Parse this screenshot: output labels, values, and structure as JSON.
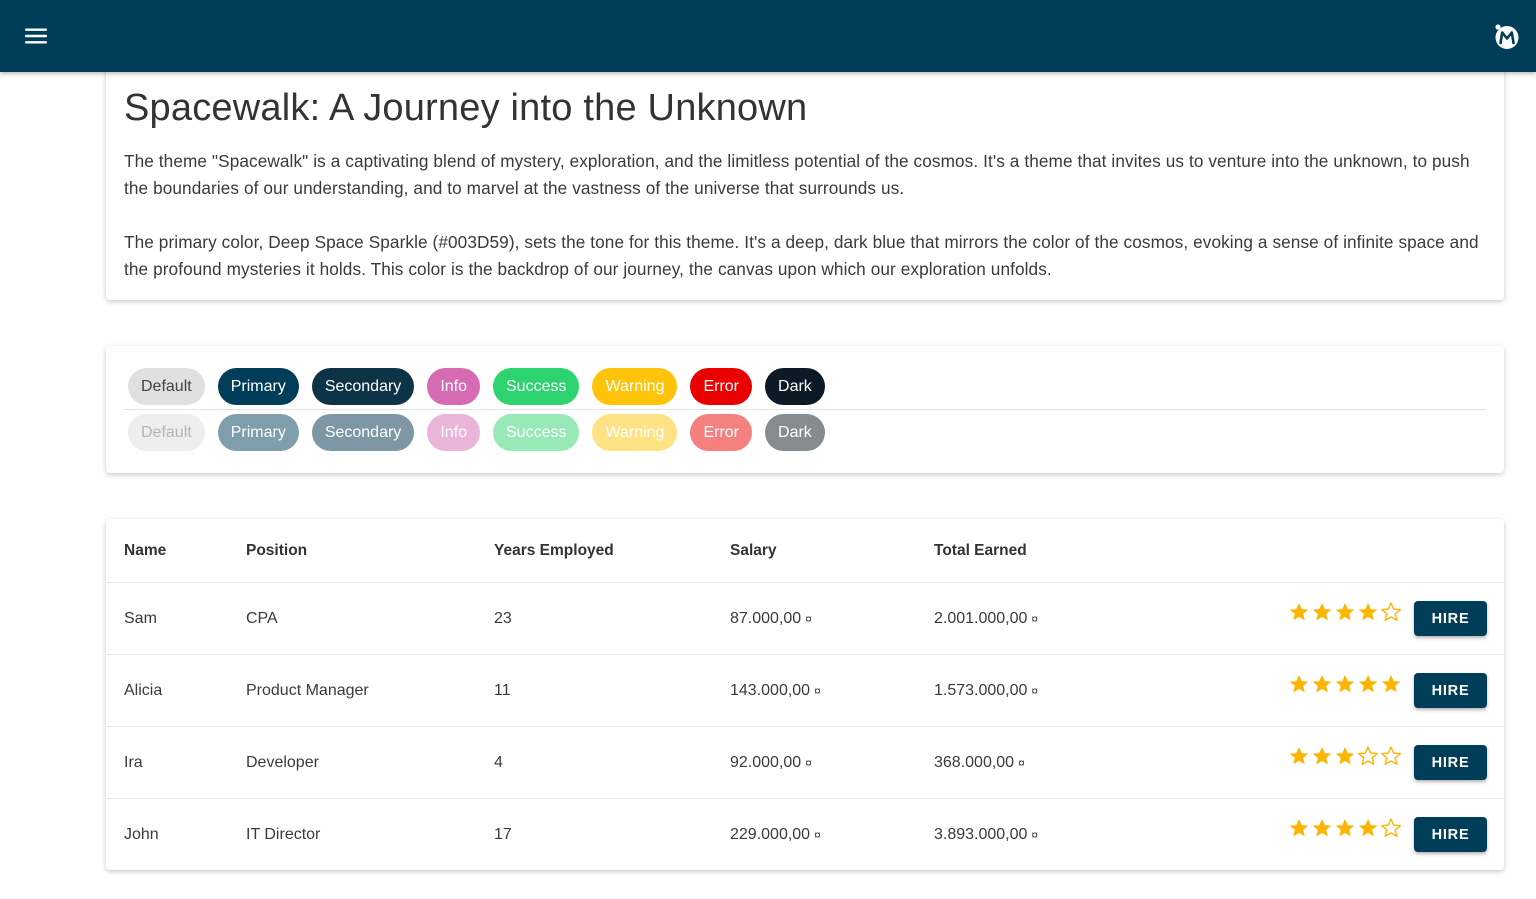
{
  "appbar": {
    "menu_icon": "hamburger-menu-icon",
    "logo_icon": "app-logo-icon",
    "color": "#003D59"
  },
  "intro": {
    "title": "Spacewalk: A Journey into the Unknown",
    "paragraph1": "The theme \"Spacewalk\" is a captivating blend of mystery, exploration, and the limitless potential of the cosmos. It's a theme that invites us to venture into the unknown, to push the boundaries of our understanding, and to marvel at the vastness of the universe that surrounds us.",
    "paragraph2": "The primary color, Deep Space Sparkle (#003D59), sets the tone for this theme. It's a deep, dark blue that mirrors the color of the cosmos, evoking a sense of infinite space and the profound mysteries it holds. This color is the backdrop of our journey, the canvas upon which our exploration unfolds."
  },
  "chips": {
    "row1": [
      "Default",
      "Primary",
      "Secondary",
      "Info",
      "Success",
      "Warning",
      "Error",
      "Dark"
    ],
    "row2": [
      "Default",
      "Primary",
      "Secondary",
      "Info",
      "Success",
      "Warning",
      "Error",
      "Dark"
    ],
    "colors": {
      "default": "#e0e0e0",
      "primary": "#003D59",
      "secondary": "#0c3446",
      "info": "#d66bb3",
      "success": "#2dd36f",
      "warning": "#ffc409",
      "error": "#eb0000",
      "dark": "#0b1a24"
    }
  },
  "table": {
    "headers": {
      "name": "Name",
      "position": "Position",
      "years": "Years Employed",
      "salary": "Salary",
      "total": "Total Earned"
    },
    "currency_symbol": "¤",
    "hire_label": "HIRE",
    "star_color": "#ffb400",
    "rows": [
      {
        "name": "Sam",
        "position": "CPA",
        "years": "23",
        "salary": "87.000,00",
        "total": "2.001.000,00",
        "rating": 4
      },
      {
        "name": "Alicia",
        "position": "Product Manager",
        "years": "11",
        "salary": "143.000,00",
        "total": "1.573.000,00",
        "rating": 5
      },
      {
        "name": "Ira",
        "position": "Developer",
        "years": "4",
        "salary": "92.000,00",
        "total": "368.000,00",
        "rating": 3
      },
      {
        "name": "John",
        "position": "IT Director",
        "years": "17",
        "salary": "229.000,00",
        "total": "3.893.000,00",
        "rating": 4
      }
    ]
  }
}
